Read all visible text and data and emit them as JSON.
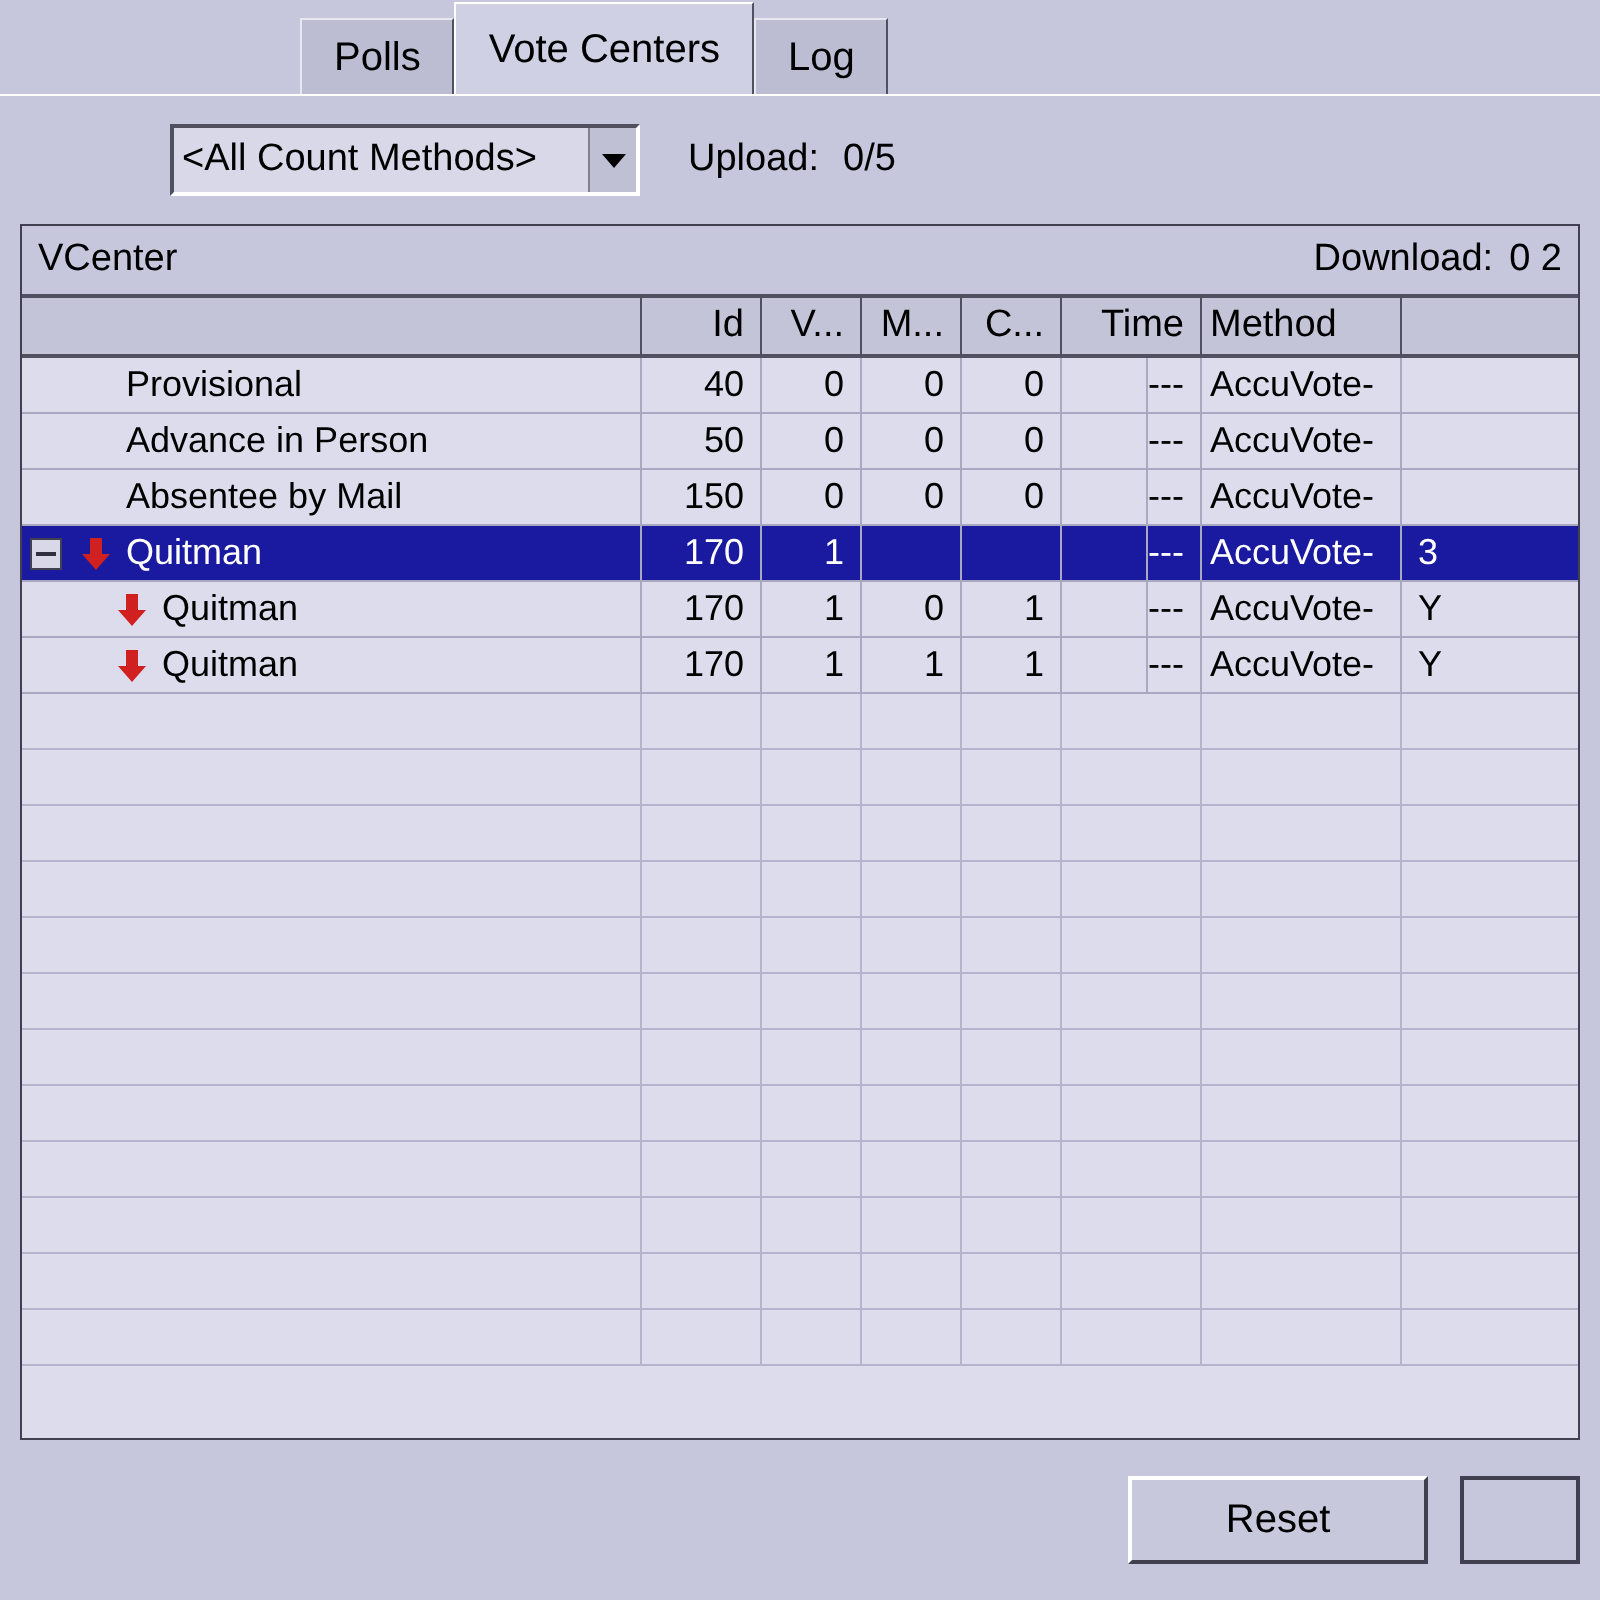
{
  "tabs": [
    {
      "label": "Polls",
      "selected": false
    },
    {
      "label": "Vote Centers",
      "selected": true
    },
    {
      "label": "Log",
      "selected": false
    }
  ],
  "count_method": {
    "value": "<All Count Methods>"
  },
  "upload": {
    "label": "Upload:",
    "value": "0/5"
  },
  "group": {
    "title": "VCenter"
  },
  "download": {
    "label": "Download:",
    "value": "0 2"
  },
  "table": {
    "columns": [
      "Id",
      "V...",
      "M...",
      "C...",
      "Time",
      "Method"
    ],
    "rows": [
      {
        "name": "Provisional",
        "kind": "plain",
        "selected": false,
        "cells": [
          "40",
          "0",
          "0",
          "0",
          "---",
          "AccuVote-"
        ]
      },
      {
        "name": "Advance in Person",
        "kind": "plain",
        "selected": false,
        "cells": [
          "50",
          "0",
          "0",
          "0",
          "---",
          "AccuVote-"
        ]
      },
      {
        "name": "Absentee by Mail",
        "kind": "plain",
        "selected": false,
        "cells": [
          "150",
          "0",
          "0",
          "0",
          "---",
          "AccuVote-"
        ]
      },
      {
        "name": "Quitman",
        "kind": "arrow",
        "selected": true,
        "expanded": true,
        "cells": [
          "170",
          "1",
          "",
          "",
          "---",
          "AccuVote-"
        ],
        "column_9": "3",
        "children": [
          {
            "name": "Quitman",
            "kind": "arrow",
            "selected": false,
            "cells": [
              "170",
              "1",
              "0",
              "1",
              "---",
              "AccuVote-"
            ],
            "column_9": "Y"
          },
          {
            "name": "Quitman",
            "kind": "arrow",
            "selected": false,
            "cells": [
              "170",
              "1",
              "1",
              "1",
              "---",
              "AccuVote-"
            ],
            "column_9": "Y"
          }
        ]
      }
    ]
  },
  "buttons": [
    {
      "label": "Reset"
    }
  ]
}
